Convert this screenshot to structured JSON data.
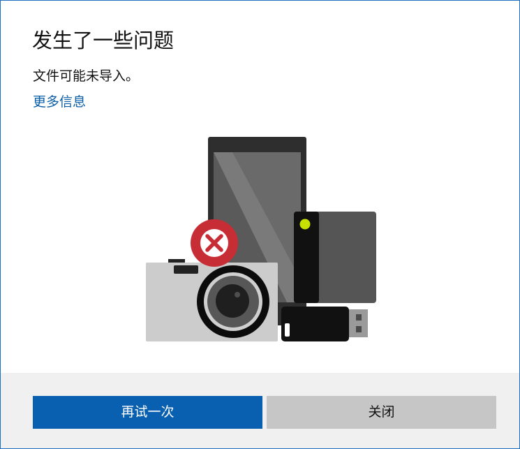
{
  "dialog": {
    "title": "发生了一些问题",
    "message": "文件可能未导入。",
    "more_info_link": "更多信息"
  },
  "illustration": {
    "icons": [
      "phone-icon",
      "camera-icon",
      "external-drive-icon",
      "usb-drive-icon",
      "error-icon"
    ],
    "colors": {
      "error_badge": "#c62d35",
      "drive_led": "#c8e000"
    }
  },
  "footer": {
    "retry_label": "再试一次",
    "close_label": "关闭"
  },
  "colors": {
    "accent": "#0a60b0",
    "link": "#0b5ea8",
    "secondary_button": "#c6c6c6",
    "footer_bg": "#f0f0f0"
  }
}
